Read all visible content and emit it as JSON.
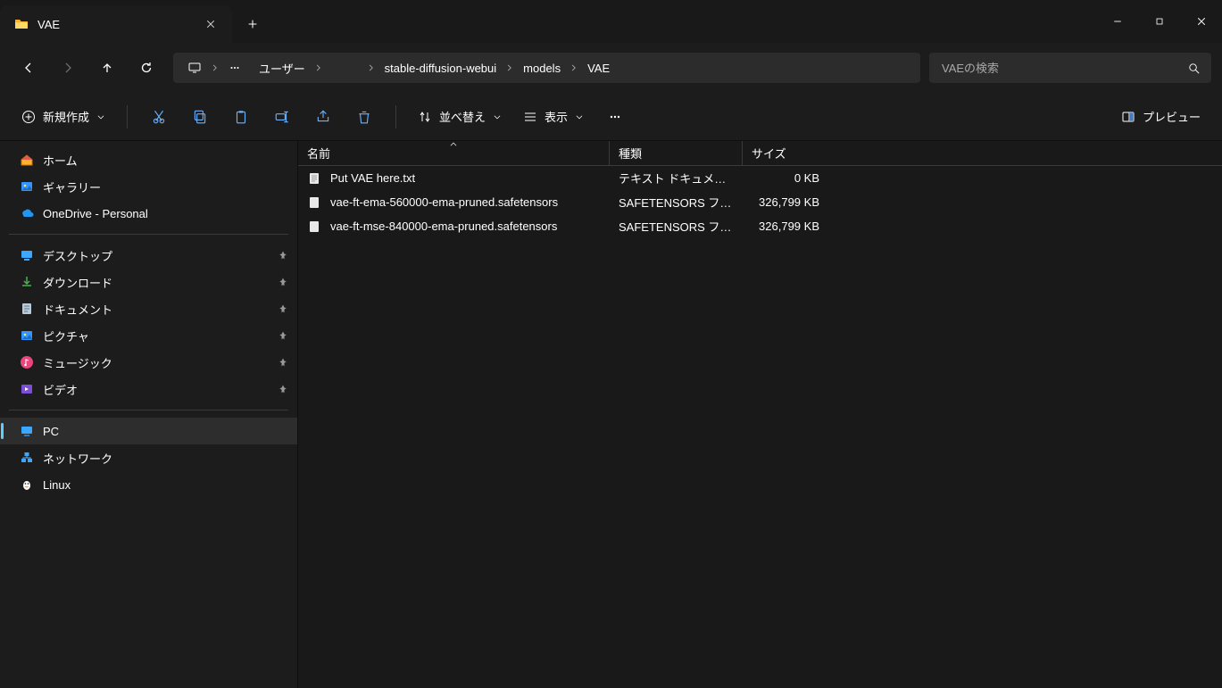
{
  "window": {
    "title": "VAE"
  },
  "nav": {
    "crumbs": [
      "ユーザー",
      "",
      "stable-diffusion-webui",
      "models",
      "VAE"
    ]
  },
  "search": {
    "placeholder": "VAEの検索"
  },
  "toolbar": {
    "new_label": "新規作成",
    "sort_label": "並べ替え",
    "view_label": "表示",
    "preview_label": "プレビュー"
  },
  "sidebar": {
    "top": [
      {
        "label": "ホーム",
        "icon": "home"
      },
      {
        "label": "ギャラリー",
        "icon": "gallery"
      },
      {
        "label": "OneDrive - Personal",
        "icon": "onedrive"
      }
    ],
    "quick": [
      {
        "label": "デスクトップ",
        "icon": "desktop"
      },
      {
        "label": "ダウンロード",
        "icon": "download"
      },
      {
        "label": "ドキュメント",
        "icon": "document"
      },
      {
        "label": "ピクチャ",
        "icon": "gallery"
      },
      {
        "label": "ミュージック",
        "icon": "music"
      },
      {
        "label": "ビデオ",
        "icon": "video"
      }
    ],
    "bottom": [
      {
        "label": "PC",
        "icon": "pc",
        "selected": true
      },
      {
        "label": "ネットワーク",
        "icon": "network"
      },
      {
        "label": "Linux",
        "icon": "linux"
      }
    ]
  },
  "columns": {
    "name": "名前",
    "type": "種類",
    "size": "サイズ"
  },
  "files": [
    {
      "name": "Put VAE here.txt",
      "type": "テキスト ドキュメント",
      "size": "0 KB",
      "icon": "txt"
    },
    {
      "name": "vae-ft-ema-560000-ema-pruned.safetensors",
      "type": "SAFETENSORS ファ...",
      "size": "326,799 KB",
      "icon": "file"
    },
    {
      "name": "vae-ft-mse-840000-ema-pruned.safetensors",
      "type": "SAFETENSORS ファ...",
      "size": "326,799 KB",
      "icon": "file"
    }
  ]
}
